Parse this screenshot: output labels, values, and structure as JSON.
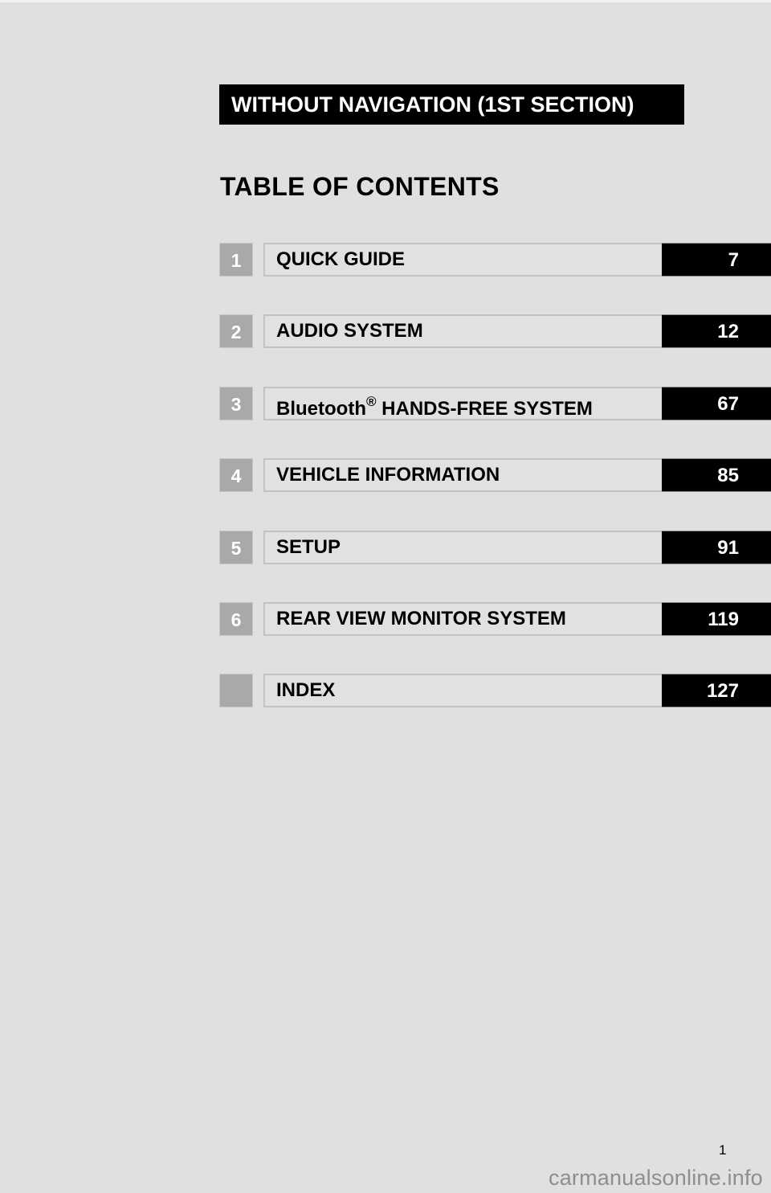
{
  "banner": "WITHOUT NAVIGATION (1ST SECTION)",
  "title": "TABLE OF CONTENTS",
  "entries": [
    {
      "number": "1",
      "label": "QUICK GUIDE",
      "page": "7"
    },
    {
      "number": "2",
      "label": "AUDIO SYSTEM",
      "page": "12"
    },
    {
      "number": "3",
      "label": "Bluetooth",
      "label_sup": "®",
      "label_rest": " HANDS-FREE SYSTEM",
      "page": "67"
    },
    {
      "number": "4",
      "label": "VEHICLE INFORMATION",
      "page": "85"
    },
    {
      "number": "5",
      "label": "SETUP",
      "page": "91"
    },
    {
      "number": "6",
      "label": "REAR VIEW MONITOR SYSTEM",
      "page": "119"
    },
    {
      "number": "",
      "label": "INDEX",
      "page": "127"
    }
  ],
  "page_number": "1",
  "watermark": "carmanualsonline.info"
}
